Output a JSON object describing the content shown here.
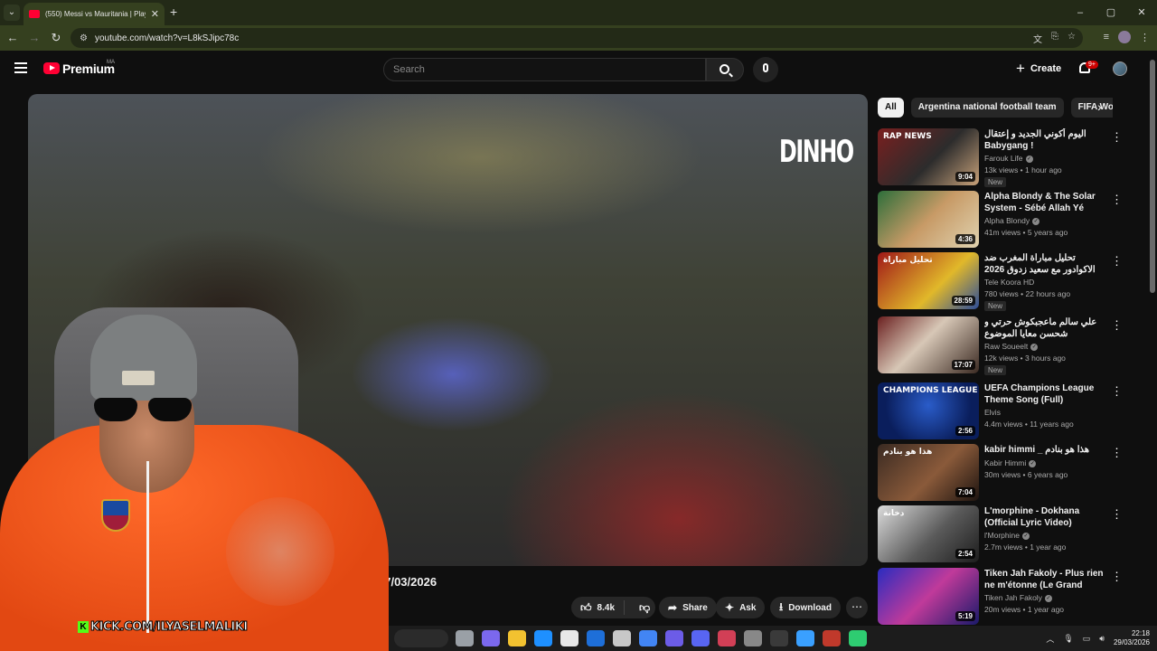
{
  "browser": {
    "tab_title": "(550) Messi vs Mauritania | Play",
    "new_tab": "+",
    "url": "youtube.com/watch?v=L8kSJipc78c",
    "window_controls": [
      "–",
      "▢",
      "✕"
    ]
  },
  "header": {
    "brand": "Premium",
    "country": "MA",
    "search_placeholder": "Search",
    "create_label": "Create",
    "notif_count": "9+"
  },
  "player": {
    "watermark": "DINHO",
    "date": "27/03/2026"
  },
  "actions": {
    "like_count": "8.4k",
    "share": "Share",
    "ask": "Ask",
    "download": "Download"
  },
  "overlay": {
    "kick_handle": "KICK.COM/ILYASELMALIKI"
  },
  "chips": [
    "All",
    "Argentina national football team",
    "FIFA Wo"
  ],
  "recommendations": [
    {
      "title": "اليوم أكوني الجديد و إعتقال Babygang !",
      "channel": "Farouk Life",
      "verified": true,
      "meta": "13k views • 1 hour ago",
      "new": "New",
      "duration": "9:04",
      "caption": "RAP NEWS",
      "bg": "linear-gradient(135deg,#7a1f1f,#2c2c2c 55%,#c9a27a)"
    },
    {
      "title": "Alpha Blondy & The Solar System - Sébé Allah Yé (Live)",
      "channel": "Alpha Blondy",
      "verified": true,
      "meta": "41m views • 5 years ago",
      "new": "",
      "duration": "4:36",
      "caption": "",
      "bg": "linear-gradient(135deg,#2d6e3a,#c79a66 50%,#e0d3b0)"
    },
    {
      "title": "تحليل مباراة المغرب ضد الاكوادور مع سعيد زدوق 2026",
      "channel": "Tele Koora HD",
      "verified": false,
      "meta": "780 views • 22 hours ago",
      "new": "New",
      "duration": "28:59",
      "caption": "تحليل مباراة",
      "bg": "linear-gradient(135deg,#a01818,#e1b82a 60%,#2c4d9a)"
    },
    {
      "title": "علي سالم ماعجبكوش حرتي و شحسن معايا الموضوع",
      "channel": "Raw Soueelt",
      "verified": true,
      "meta": "12k views • 3 hours ago",
      "new": "New",
      "duration": "17:07",
      "caption": "",
      "bg": "linear-gradient(135deg,#6b2020,#d7c7b6 45%,#3b2a22)"
    },
    {
      "title": "UEFA Champions League Theme Song (Full)",
      "channel": "Elvis",
      "verified": false,
      "meta": "4.4m views • 11 years ago",
      "new": "",
      "duration": "2:56",
      "caption": "CHAMPIONS LEAGUE",
      "bg": "radial-gradient(circle at 50% 40%,#2a5cc9,#0a1e5c 70%)"
    },
    {
      "title": "kabir himmi _ هذا هو بنادم",
      "channel": "Kabir Himmi",
      "verified": true,
      "meta": "30m views • 6 years ago",
      "new": "",
      "duration": "7:04",
      "caption": "هذا هو بنادم",
      "bg": "linear-gradient(135deg,#3a2a22,#8a5a3a 55%,#1d1410)"
    },
    {
      "title": "L'morphine - Dokhana (Official Lyric Video)",
      "channel": "l'Morphine",
      "verified": true,
      "meta": "2.7m views • 1 year ago",
      "new": "",
      "duration": "2:54",
      "caption": "دخانة",
      "bg": "linear-gradient(135deg,#dcdcdc,#5a5a5a 55%,#1d1d1d)"
    },
    {
      "title": "Tiken Jah Fakoly - Plus rien ne m'étonne (Le Grand Choral 20...",
      "channel": "Tiken Jah Fakoly",
      "verified": true,
      "meta": "20m views • 1 year ago",
      "new": "",
      "duration": "5:19",
      "caption": "",
      "bg": "linear-gradient(135deg,#2a2cc0,#c03a9a 50%,#1a1a6a)"
    }
  ],
  "taskbar": {
    "time": "22:18",
    "date": "29/03/2026",
    "apps": [
      "#9aa0a6",
      "#7b68ee",
      "#f2c230",
      "#1e90ff",
      "#e8e8e8",
      "#1e6fd9",
      "#c8c8c8",
      "#4285f4",
      "#6c5ce7",
      "#5865f2",
      "#d23f56",
      "#888888",
      "#3a3a3a",
      "#3aa0ff",
      "#c0392b",
      "#2ecc71"
    ]
  },
  "colors": {
    "accent_red": "#ff0033",
    "kick_green": "#53fc18",
    "chrome_olive": "#35401f"
  }
}
